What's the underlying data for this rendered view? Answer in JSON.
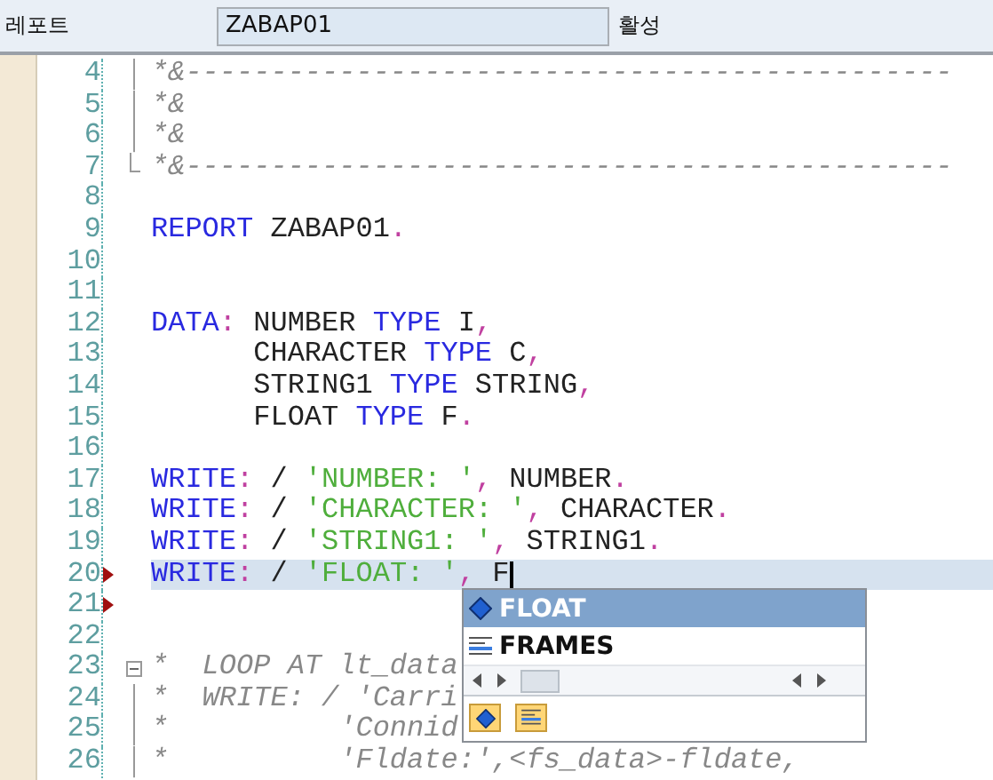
{
  "header": {
    "label": "레포트",
    "program_field": {
      "value": "ZABAP01"
    },
    "status": "활성"
  },
  "editor": {
    "lines": [
      {
        "number": "4",
        "kind": "fold",
        "marker": false,
        "highlighted": false,
        "cursor": false,
        "tokens": [
          {
            "kind": "comment",
            "text": "*&---------------------------------------------"
          }
        ]
      },
      {
        "number": "5",
        "kind": "fold",
        "marker": false,
        "highlighted": false,
        "cursor": false,
        "tokens": [
          {
            "kind": "comment",
            "text": "*&"
          }
        ]
      },
      {
        "number": "6",
        "kind": "fold",
        "marker": false,
        "highlighted": false,
        "cursor": false,
        "tokens": [
          {
            "kind": "comment",
            "text": "*&"
          }
        ]
      },
      {
        "number": "7",
        "kind": "fold_end",
        "marker": false,
        "highlighted": false,
        "cursor": false,
        "tokens": [
          {
            "kind": "comment",
            "text": "*&---------------------------------------------"
          }
        ]
      },
      {
        "number": "8",
        "marker": false,
        "highlighted": false,
        "cursor": false
      },
      {
        "number": "9",
        "marker": false,
        "highlighted": false,
        "cursor": false,
        "tokens": [
          {
            "kind": "keyword",
            "text": "REPORT"
          },
          {
            "kind": "plain",
            "text": " ZABAP01"
          },
          {
            "kind": "punct",
            "text": "."
          }
        ]
      },
      {
        "number": "10",
        "marker": false,
        "highlighted": false,
        "cursor": false
      },
      {
        "number": "11",
        "marker": false,
        "highlighted": false,
        "cursor": false
      },
      {
        "number": "12",
        "marker": false,
        "highlighted": false,
        "cursor": false,
        "tokens": [
          {
            "kind": "keyword",
            "text": "DATA"
          },
          {
            "kind": "punct",
            "text": ":"
          },
          {
            "kind": "plain",
            "text": " NUMBER "
          },
          {
            "kind": "keyword",
            "text": "TYPE"
          },
          {
            "kind": "plain",
            "text": " I"
          },
          {
            "kind": "punct",
            "text": ","
          }
        ]
      },
      {
        "number": "13",
        "marker": false,
        "highlighted": false,
        "cursor": false,
        "tokens": [
          {
            "kind": "plain",
            "text": "      CHARACTER "
          },
          {
            "kind": "keyword",
            "text": "TYPE"
          },
          {
            "kind": "plain",
            "text": " C"
          },
          {
            "kind": "punct",
            "text": ","
          }
        ]
      },
      {
        "number": "14",
        "marker": false,
        "highlighted": false,
        "cursor": false,
        "tokens": [
          {
            "kind": "plain",
            "text": "      STRING1 "
          },
          {
            "kind": "keyword",
            "text": "TYPE"
          },
          {
            "kind": "plain",
            "text": " STRING"
          },
          {
            "kind": "punct",
            "text": ","
          }
        ]
      },
      {
        "number": "15",
        "marker": false,
        "highlighted": false,
        "cursor": false,
        "tokens": [
          {
            "kind": "plain",
            "text": "      FLOAT "
          },
          {
            "kind": "keyword",
            "text": "TYPE"
          },
          {
            "kind": "plain",
            "text": " F"
          },
          {
            "kind": "punct",
            "text": "."
          }
        ]
      },
      {
        "number": "16",
        "marker": false,
        "highlighted": false,
        "cursor": false
      },
      {
        "number": "17",
        "marker": false,
        "highlighted": false,
        "cursor": false,
        "tokens": [
          {
            "kind": "keyword",
            "text": "WRITE"
          },
          {
            "kind": "punct",
            "text": ":"
          },
          {
            "kind": "plain",
            "text": " / "
          },
          {
            "kind": "string",
            "text": "'NUMBER: '"
          },
          {
            "kind": "punct",
            "text": ","
          },
          {
            "kind": "plain",
            "text": " NUMBER"
          },
          {
            "kind": "punct",
            "text": "."
          }
        ]
      },
      {
        "number": "18",
        "marker": false,
        "highlighted": false,
        "cursor": false,
        "tokens": [
          {
            "kind": "keyword",
            "text": "WRITE"
          },
          {
            "kind": "punct",
            "text": ":"
          },
          {
            "kind": "plain",
            "text": " / "
          },
          {
            "kind": "string",
            "text": "'CHARACTER: '"
          },
          {
            "kind": "punct",
            "text": ","
          },
          {
            "kind": "plain",
            "text": " CHARACTER"
          },
          {
            "kind": "punct",
            "text": "."
          }
        ]
      },
      {
        "number": "19",
        "marker": false,
        "highlighted": false,
        "cursor": false,
        "tokens": [
          {
            "kind": "keyword",
            "text": "WRITE"
          },
          {
            "kind": "punct",
            "text": ":"
          },
          {
            "kind": "plain",
            "text": " / "
          },
          {
            "kind": "string",
            "text": "'STRING1: '"
          },
          {
            "kind": "punct",
            "text": ","
          },
          {
            "kind": "plain",
            "text": " STRING1"
          },
          {
            "kind": "punct",
            "text": "."
          }
        ]
      },
      {
        "number": "20",
        "marker": true,
        "highlighted": true,
        "cursor": true,
        "tokens": [
          {
            "kind": "keyword",
            "text": "WRITE"
          },
          {
            "kind": "punct",
            "text": ":"
          },
          {
            "kind": "plain",
            "text": " / "
          },
          {
            "kind": "string",
            "text": "'FLOAT: '"
          },
          {
            "kind": "punct",
            "text": ","
          },
          {
            "kind": "plain",
            "text": " F"
          }
        ]
      },
      {
        "number": "21",
        "marker": true,
        "highlighted": false,
        "cursor": false
      },
      {
        "number": "22",
        "marker": false,
        "highlighted": false,
        "cursor": false
      },
      {
        "number": "23",
        "kind": "fold_box",
        "marker": false,
        "highlighted": false,
        "cursor": false,
        "tokens": [
          {
            "kind": "comment",
            "text": "*  LOOP AT lt_data"
          }
        ]
      },
      {
        "number": "24",
        "kind": "guide",
        "marker": false,
        "highlighted": false,
        "cursor": false,
        "tokens": [
          {
            "kind": "comment",
            "text": "*  WRITE: / 'Carri"
          }
        ]
      },
      {
        "number": "25",
        "kind": "guide",
        "marker": false,
        "highlighted": false,
        "cursor": false,
        "tokens": [
          {
            "kind": "comment",
            "text": "*          'Connid"
          }
        ]
      },
      {
        "number": "26",
        "kind": "guide",
        "marker": false,
        "highlighted": false,
        "cursor": false,
        "tokens": [
          {
            "kind": "comment",
            "text": "*          'Fldate:',<fs_data>-fldate,"
          }
        ]
      }
    ]
  },
  "completion_popup": {
    "items": [
      {
        "text": "FLOAT",
        "kind": "variable",
        "selected": true
      },
      {
        "text": "FRAMES",
        "kind": "structure",
        "selected": false
      }
    ]
  }
}
